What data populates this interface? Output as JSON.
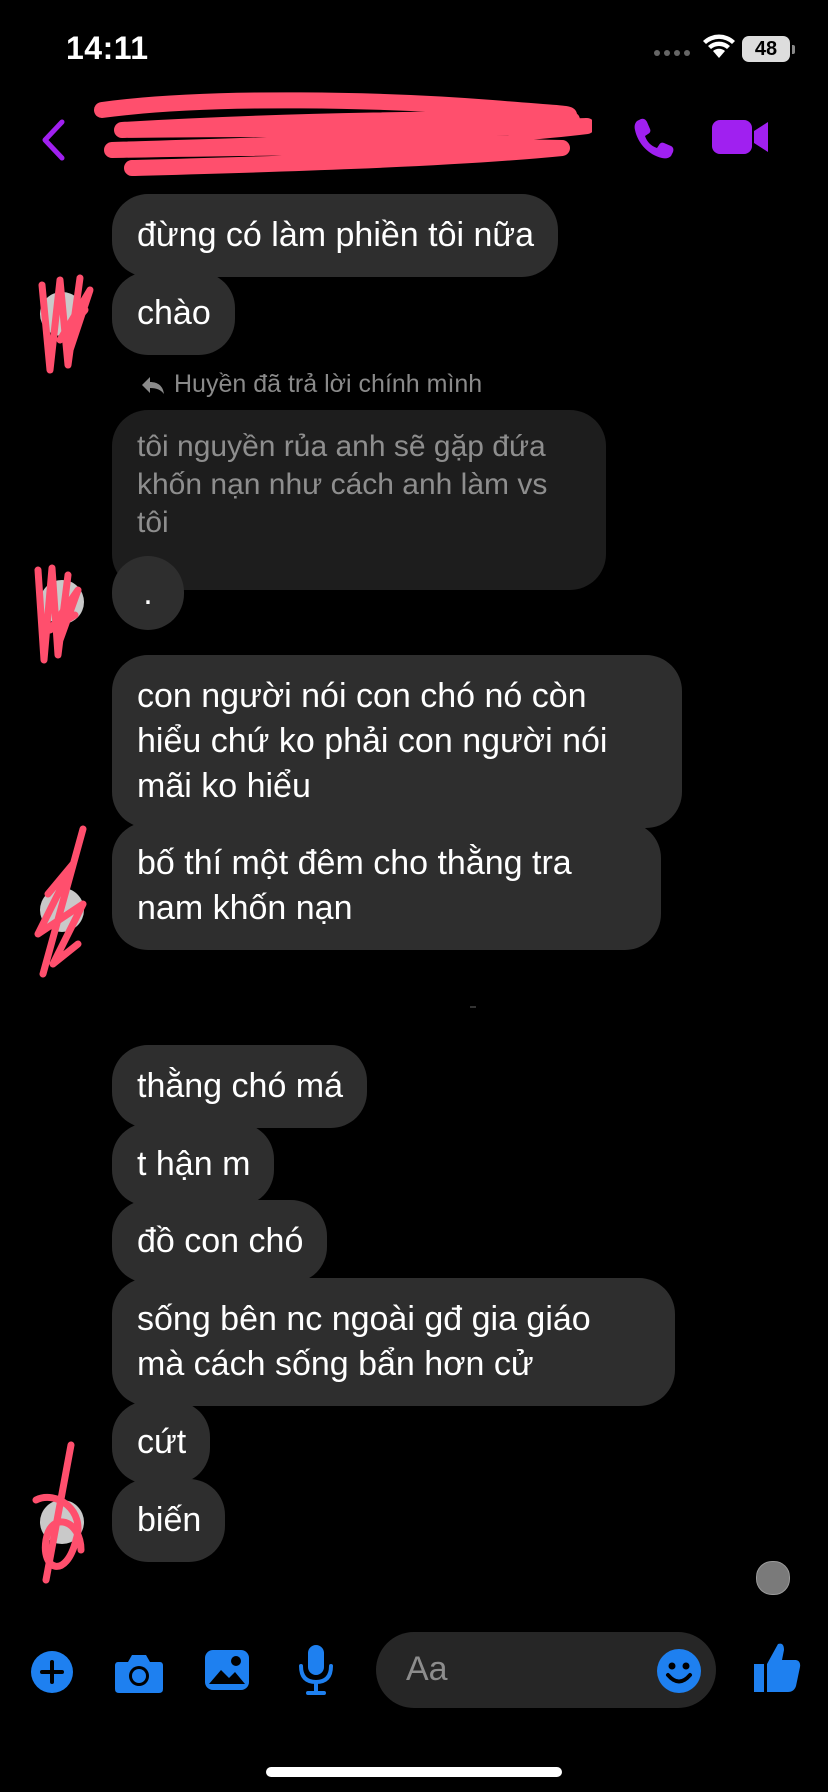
{
  "status_bar": {
    "time": "14:11",
    "battery": "48"
  },
  "header": {
    "contact_name": ""
  },
  "messages": [
    {
      "text": "đừng có làm phiền tôi nữa"
    },
    {
      "text": "chào"
    },
    {
      "text": "."
    },
    {
      "text": "con người nói con chó nó còn\nhiểu chứ ko phải con người nói\nmãi ko hiểu"
    },
    {
      "text": "bố thí một đêm cho thằng tra\nnam khốn nạn"
    },
    {
      "text": "thằng chó má"
    },
    {
      "text": "t hận m"
    },
    {
      "text": "đồ con chó"
    },
    {
      "text": "sống bên nc ngoài gđ gia giáo\nmà cách sống bẩn hơn cử"
    },
    {
      "text": "cứt"
    },
    {
      "text": "biến"
    }
  ],
  "reply": {
    "label": "Huyền đã trả lời chính mình",
    "quoted_text": "tôi nguyền rủa anh sẽ gặp đứa\nkhốn nạn như cách anh làm vs\ntôi"
  },
  "composer": {
    "placeholder": "Aa"
  },
  "colors": {
    "accent": "#a020f0",
    "tool_blue": "#1e80f0",
    "bubble": "#2e2e2e",
    "scribble": "#ff4f6d"
  }
}
